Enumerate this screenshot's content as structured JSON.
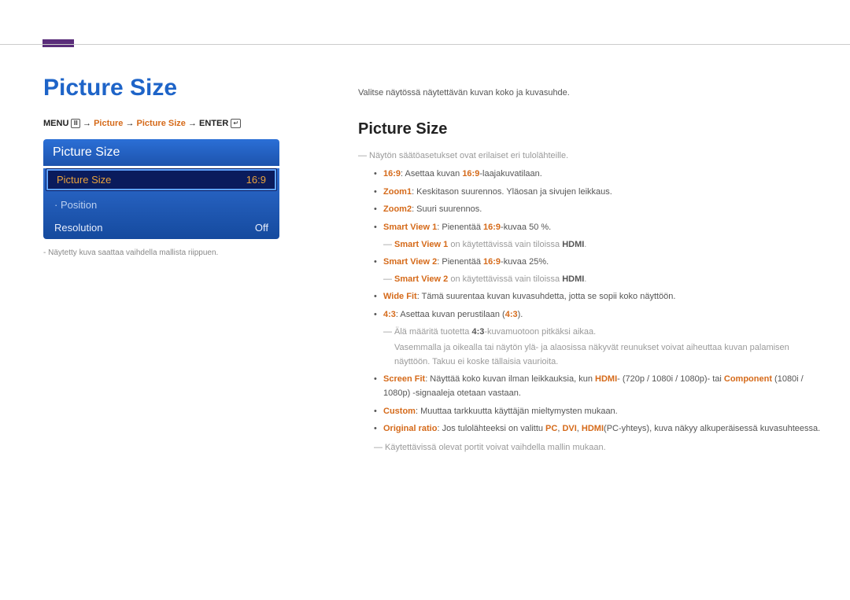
{
  "page": {
    "title": "Picture Size"
  },
  "breadcrumb": {
    "menu": "MENU",
    "arrow1": "→",
    "picture": "Picture",
    "arrow2": "→",
    "picture_size": "Picture Size",
    "arrow3": "→",
    "enter": "ENTER"
  },
  "osd": {
    "header": "Picture Size",
    "rows": {
      "r1": {
        "label": "Picture Size",
        "value": "16:9"
      },
      "r2": {
        "label": "Position"
      },
      "r3": {
        "label": "Resolution",
        "value": "Off"
      }
    }
  },
  "caption": "Näytetty kuva saattaa vaihdella mallista riippuen.",
  "intro": "Valitse näytössä näytettävän kuvan koko ja kuvasuhde.",
  "sub_title": "Picture Size",
  "note_top": "Näytön säätöasetukset ovat erilaiset eri tulolähteille.",
  "items": {
    "i1": {
      "k": "16:9",
      "t": ": Asettaa kuvan ",
      "k2": "16:9",
      "t2": "-laajakuvatilaan."
    },
    "i2": {
      "k": "Zoom1",
      "t": ": Keskitason suurennos. Yläosan ja sivujen leikkaus."
    },
    "i3": {
      "k": "Zoom2",
      "t": ": Suuri suurennos."
    },
    "i4": {
      "k": "Smart View 1",
      "t": ": Pienentää ",
      "k2": "16:9",
      "t2": "-kuvaa 50 %."
    },
    "i4_note": {
      "pre": "Smart View 1",
      "t": "  on käytettävissä vain tiloissa ",
      "post": "HDMI",
      "tail": "."
    },
    "i5": {
      "k": "Smart View 2",
      "t": ": Pienentää ",
      "k2": "16:9",
      "t2": "-kuvaa 25%."
    },
    "i5_note": {
      "pre": "Smart View 2",
      "t": "  on käytettävissä vain tiloissa ",
      "post": "HDMI",
      "tail": "."
    },
    "i6": {
      "k": "Wide Fit",
      "t": ": Tämä suurentaa kuvan kuvasuhdetta, jotta se sopii koko näyttöön."
    },
    "i7": {
      "k": "4:3",
      "t": ": Asettaa kuvan perustilaan (",
      "k2": "4:3",
      "t2": ")."
    },
    "i7_note1": {
      "t": "Älä määritä tuotetta ",
      "k": "4:3",
      "t2": "-kuvamuotoon pitkäksi aikaa."
    },
    "i7_note2": "Vasemmalla ja oikealla tai näytön ylä- ja alaosissa näkyvät reunukset voivat aiheuttaa kuvan palamisen näyttöön. Takuu ei koske tällaisia vaurioita.",
    "i8": {
      "k": "Screen Fit",
      "t": ": Näyttää koko kuvan ilman leikkauksia, kun ",
      "k2": "HDMI",
      "t2": "- (720p / 1080i / 1080p)- tai ",
      "k3": "Component",
      "t3": " (1080i / 1080p) -signaaleja otetaan vastaan."
    },
    "i9": {
      "k": "Custom",
      "t": ": Muuttaa tarkkuutta käyttäjän mieltymysten mukaan."
    },
    "i10": {
      "k": "Original ratio",
      "t": ": Jos tulolähteeksi on valittu ",
      "k2": "PC",
      "sep1": ", ",
      "k3": "DVI",
      "sep2": ", ",
      "k4": "HDMI",
      "t2": "(PC-yhteys), kuva näkyy alkuperäisessä kuvasuhteessa."
    }
  },
  "note_bottom": "Käytettävissä olevat portit voivat vaihdella mallin mukaan."
}
